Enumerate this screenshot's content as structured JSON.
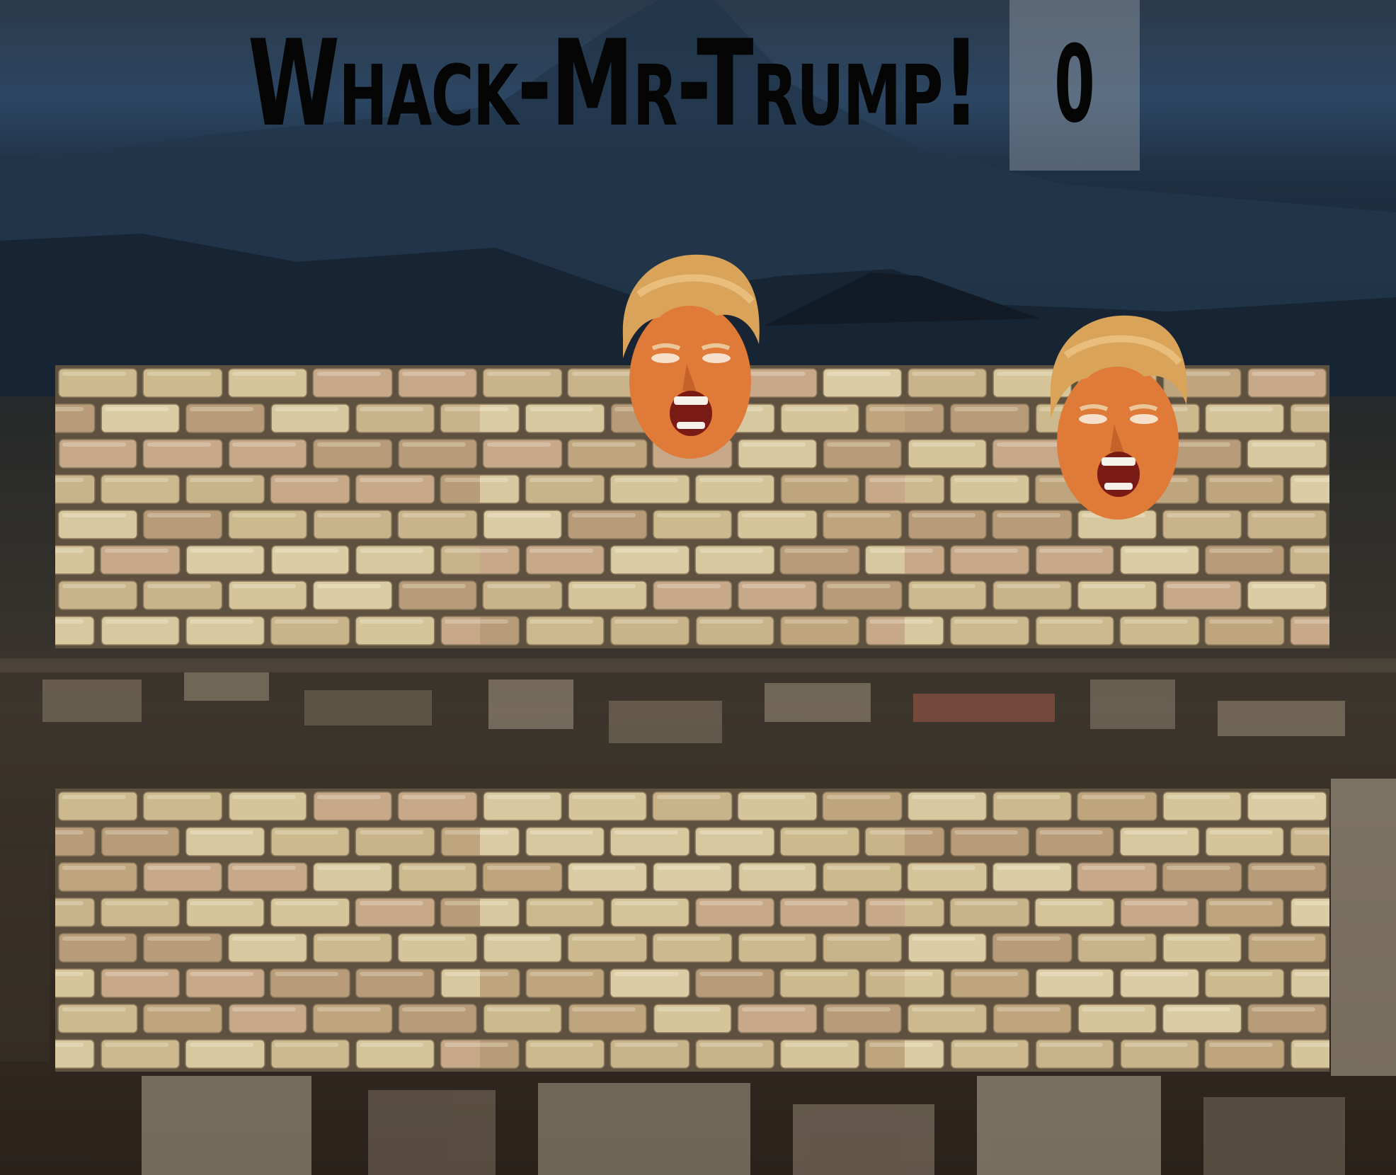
{
  "game": {
    "title": "Whack-Mr-Trump!",
    "score": "0"
  },
  "colors": {
    "title_text": "#050505",
    "score_box": "#96a0aa",
    "brick_light": "#d9c9a2",
    "brick_dark": "#a88f6a",
    "mortar": "#5e5140",
    "hair": "#d9a35a",
    "skin": "#e07a38"
  },
  "board": {
    "rows": 2,
    "cols": 3,
    "holes": [
      {
        "id": 1,
        "label": "hole-1",
        "mole_up": false
      },
      {
        "id": 2,
        "label": "hole-2",
        "mole_up": true
      },
      {
        "id": 3,
        "label": "hole-3",
        "mole_up": true
      },
      {
        "id": 4,
        "label": "hole-4",
        "mole_up": false
      },
      {
        "id": 5,
        "label": "hole-5",
        "mole_up": false
      },
      {
        "id": 6,
        "label": "hole-6",
        "mole_up": false
      }
    ]
  }
}
